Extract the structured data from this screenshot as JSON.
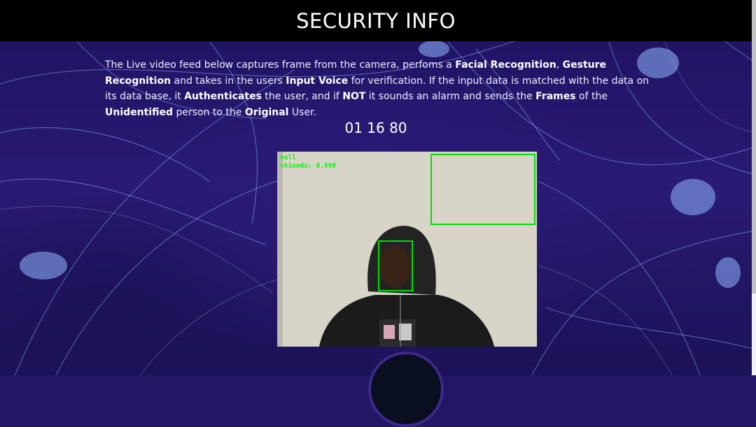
{
  "header": {
    "title": "SECURITY INFO"
  },
  "intro": {
    "p1": "The Live video feed below captures frame from the camera, perfoms a ",
    "facial": "Facial Recognition",
    "p2": ", ",
    "gesture": "Gesture Recognition",
    "p3": " and takes in the users ",
    "voice": "Input Voice",
    "p4": " for verification. If the input data is matched with the data on its data base, it ",
    "auth": "Authenticates",
    "p5": " the user, and if ",
    "not": "NOT",
    "p6": " it sounds an alarm and sends the ",
    "frames": "Frames",
    "p7": " of the ",
    "unidentified": "Unidentified",
    "p8": " person to the ",
    "original": "Original",
    "p9": " User."
  },
  "timer": {
    "value": "01 16 80"
  },
  "video": {
    "label_gesture": "null",
    "label_face": "chinedu: 0.996"
  },
  "colors": {
    "header_bg": "#000000",
    "detection_box": "#00e000",
    "background": "#231665"
  }
}
